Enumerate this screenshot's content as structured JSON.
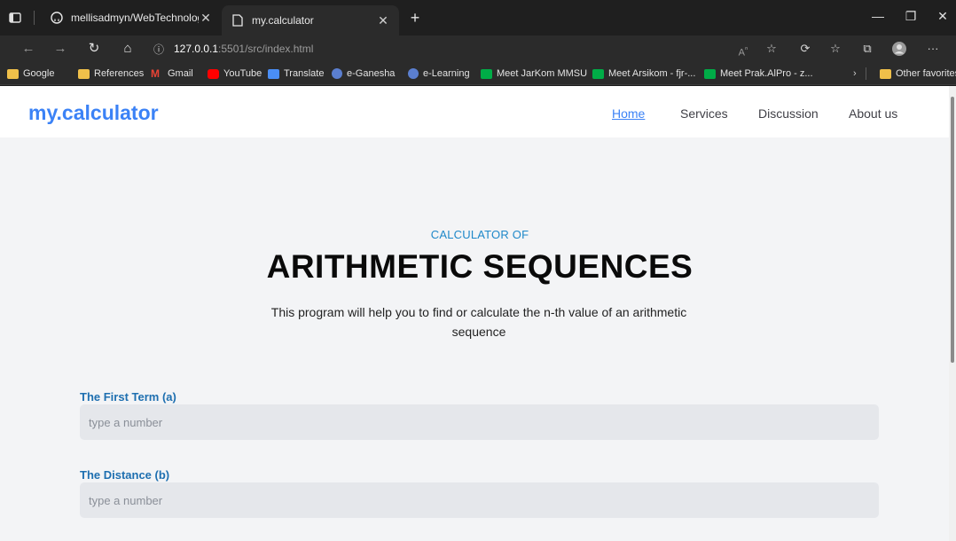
{
  "browser": {
    "tabs": [
      {
        "label": "mellisadmyn/WebTechnology: W",
        "icon": "github-icon",
        "active": false
      },
      {
        "label": "my.calculator",
        "icon": "page-icon",
        "active": true
      }
    ],
    "url_host": "127.0.0.1",
    "url_rest": ":5501/src/index.html",
    "bookmarks": [
      {
        "label": "Google",
        "icon": "folder-icon"
      },
      {
        "label": "References",
        "icon": "folder-icon"
      },
      {
        "label": "Gmail",
        "icon": "gmail-icon"
      },
      {
        "label": "YouTube",
        "icon": "youtube-icon"
      },
      {
        "label": "Translate",
        "icon": "translate-icon"
      },
      {
        "label": "e-Ganesha",
        "icon": "undiksha-icon"
      },
      {
        "label": "e-Learning",
        "icon": "undiksha-icon"
      },
      {
        "label": "Meet JarKom MMSU",
        "icon": "meet-icon"
      },
      {
        "label": "Meet Arsikom - fjr-...",
        "icon": "meet-icon"
      },
      {
        "label": "Meet Prak.AlPro - z...",
        "icon": "meet-icon"
      }
    ],
    "other_favorites": "Other favorites"
  },
  "site": {
    "logo": "my.calculator",
    "nav": [
      "Home",
      "Services",
      "Discussion",
      "About us"
    ]
  },
  "hero": {
    "kicker": "CALCULATOR OF",
    "title": "ARITHMETIC SEQUENCES",
    "description": "This program will help you to find or calculate the n-th value of an arithmetic sequence"
  },
  "form": {
    "fields": [
      {
        "label": "The First Term (a)",
        "placeholder": "type a number"
      },
      {
        "label": "The Distance (b)",
        "placeholder": "type a number"
      }
    ]
  }
}
